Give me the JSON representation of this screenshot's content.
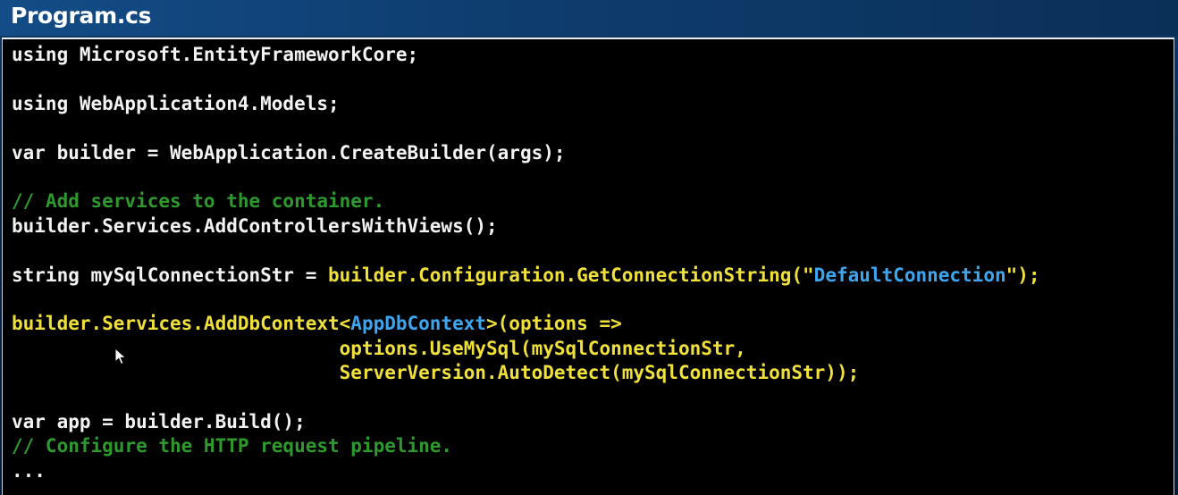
{
  "window": {
    "title": "Program.cs"
  },
  "code": {
    "lines": [
      {
        "segments": [
          {
            "text": "using Microsoft.EntityFrameworkCore;",
            "color": "#f2f2f2"
          }
        ]
      },
      {
        "segments": []
      },
      {
        "segments": [
          {
            "text": "using WebApplication4.Models;",
            "color": "#f2f2f2"
          }
        ]
      },
      {
        "segments": []
      },
      {
        "segments": [
          {
            "text": "var builder = WebApplication.CreateBuilder(args);",
            "color": "#f2f2f2"
          }
        ]
      },
      {
        "segments": []
      },
      {
        "segments": [
          {
            "text": "// Add services to the container.",
            "color": "#2e9a2e"
          }
        ]
      },
      {
        "segments": [
          {
            "text": "builder.Services.AddControllersWithViews();",
            "color": "#f2f2f2"
          }
        ]
      },
      {
        "segments": []
      },
      {
        "segments": [
          {
            "text": "string mySqlConnectionStr = ",
            "color": "#f2f2f2"
          },
          {
            "text": "builder.Configuration.GetConnectionString(\"",
            "color": "#f0e03a"
          },
          {
            "text": "DefaultConnection",
            "color": "#3ea6f0"
          },
          {
            "text": "\");",
            "color": "#f0e03a"
          }
        ]
      },
      {
        "segments": []
      },
      {
        "segments": [
          {
            "text": "builder.Services.AddDbContext<",
            "color": "#f0e03a"
          },
          {
            "text": "AppDbContext",
            "color": "#3ea6f0"
          },
          {
            "text": ">(options =>",
            "color": "#f0e03a"
          }
        ]
      },
      {
        "segments": [
          {
            "text": "                             options.UseMySql(mySqlConnectionStr,",
            "color": "#f0e03a"
          }
        ]
      },
      {
        "segments": [
          {
            "text": "                             ServerVersion.AutoDetect(mySqlConnectionStr));",
            "color": "#f0e03a"
          }
        ]
      },
      {
        "segments": []
      },
      {
        "segments": [
          {
            "text": "var app = builder.Build();",
            "color": "#f2f2f2"
          }
        ]
      },
      {
        "segments": [
          {
            "text": "// Configure the HTTP request pipeline.",
            "color": "#2e9a2e"
          }
        ]
      },
      {
        "segments": [
          {
            "text": "...",
            "color": "#f2f2f2"
          }
        ]
      }
    ]
  },
  "icons": {
    "cursor": "mouse-pointer-icon"
  },
  "colors": {
    "background_top": "#134c86",
    "code_background": "#000000",
    "keyword_text": "#f2f2f2",
    "highlight_yellow": "#f0e03a",
    "highlight_cyan": "#3ea6f0",
    "comment_green": "#2e9a2e"
  }
}
